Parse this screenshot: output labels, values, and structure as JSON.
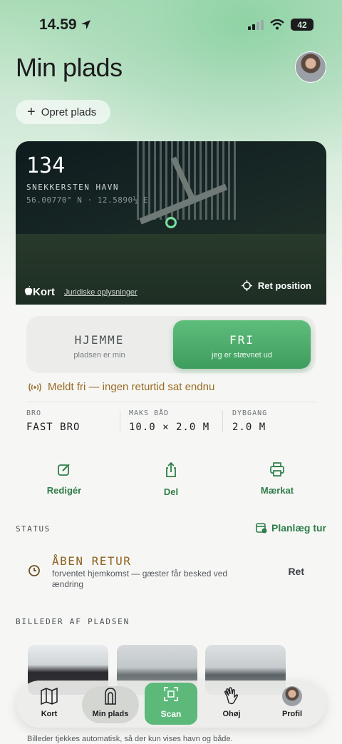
{
  "status_bar": {
    "time": "14.59",
    "battery": "42"
  },
  "header": {
    "title": "Min plads",
    "create_label": "Opret plads"
  },
  "map": {
    "berth_number": "134",
    "harbor": "SNEKKERSTEN HAVN",
    "coords": "56.00770° N · 12.5890⅓ E",
    "provider": "Kort",
    "legal": "Juridiske oplysninger",
    "adjust_label": "Ret position"
  },
  "toggle": {
    "home_title": "HJEMME",
    "home_sub": "pladsen er min",
    "free_title": "FRI",
    "free_sub": "jeg er stævnet ud",
    "selected": "FRI"
  },
  "notice": "Meldt fri — ingen returtid sat endnu",
  "specs": [
    {
      "key": "BRO",
      "value": "FAST BRO"
    },
    {
      "key": "MAKS BÅD",
      "value": "10.0 × 2.0 M"
    },
    {
      "key": "DYBGANG",
      "value": "2.0 M"
    }
  ],
  "actions": {
    "edit": "Redigér",
    "share": "Del",
    "label": "Mærkat"
  },
  "status": {
    "section_label": "STATUS",
    "plan_label": "Planlæg tur",
    "title": "ÅBEN RETUR",
    "desc": "forventet hjemkomst — gæster får besked ved ændring",
    "action": "Ret"
  },
  "photos": {
    "section_label": "BILLEDER AF PLADSEN",
    "note": "Billeder tjekkes automatisk, så der kun vises havn og både."
  },
  "tabbar": {
    "map": "Kort",
    "berth": "Min plads",
    "scan": "Scan",
    "ahoy": "Ohøj",
    "profile": "Profil"
  },
  "colors": {
    "accent_green": "#3e9d5e",
    "warning_brown": "#9a6a24"
  },
  "icons": [
    "location-arrow-icon",
    "wifi-icon",
    "plus-icon",
    "crosshair-icon",
    "radio-waves-icon",
    "edit-icon",
    "share-icon",
    "printer-icon",
    "calendar-icon",
    "clock-icon",
    "map-icon",
    "buoy-icon",
    "qr-scan-icon",
    "wave-hand-icon"
  ]
}
